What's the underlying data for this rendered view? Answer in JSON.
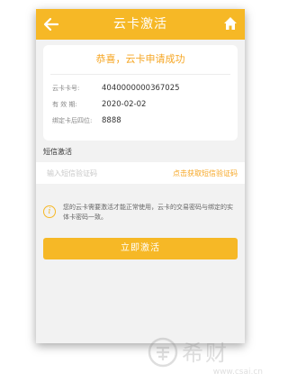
{
  "header": {
    "title": "云卡激活",
    "back_icon": "back-arrow-icon",
    "home_icon": "home-icon",
    "bar_color": "#f6b826"
  },
  "card": {
    "success_message": "恭喜，云卡申请成功",
    "rows": [
      {
        "label": "云卡卡号:",
        "value": "4040000000367025"
      },
      {
        "label": "有 效 期:",
        "value": "2020-02-02"
      },
      {
        "label": "绑定卡后四位:",
        "value": "8888"
      }
    ]
  },
  "sms": {
    "section_label": "短信激活",
    "placeholder": "输入短信验证码",
    "value": "",
    "get_code_label": "点击获取短信验证码"
  },
  "notice": {
    "icon": "info-icon",
    "text": "您的云卡需要激活才能正常使用，云卡的交易密码与绑定的实体卡密码一致。"
  },
  "activate_button": {
    "label": "立即激活"
  },
  "watermark": {
    "brand": "希财",
    "url": "www.csai.cn"
  },
  "colors": {
    "accent": "#f6b826",
    "accent_text": "#f6a623"
  }
}
